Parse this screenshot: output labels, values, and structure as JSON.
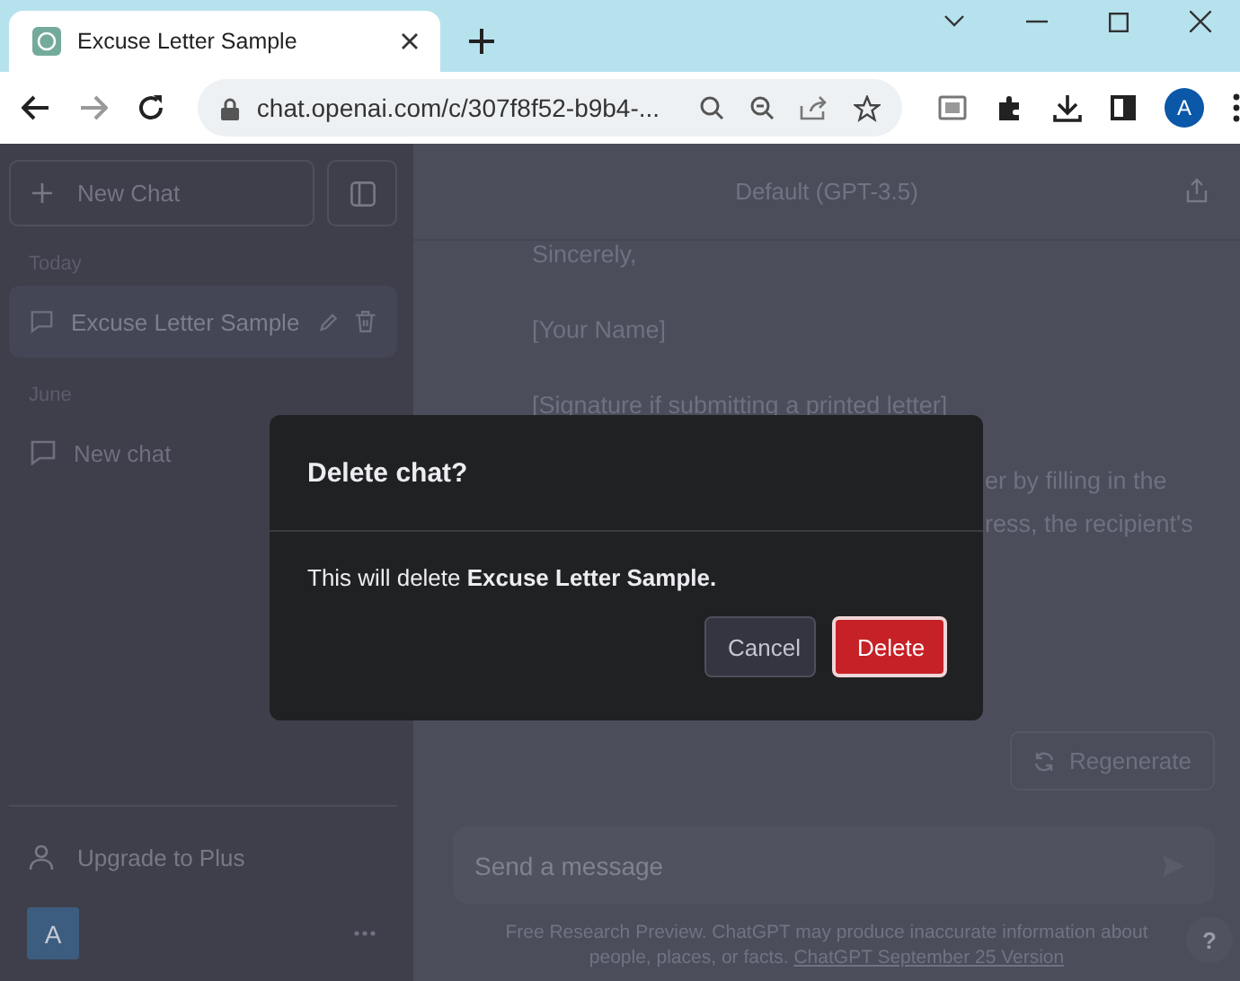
{
  "browser": {
    "tab": {
      "title": "Excuse Letter Sample",
      "selected": true
    },
    "url": "chat.openai.com/c/307f8f52-b9b4-...",
    "profile": "A"
  },
  "sidebar": {
    "new_chat": "New Chat",
    "sections": [
      {
        "heading": "Today",
        "items": [
          {
            "title": "Excuse Letter Sample",
            "selected": true
          }
        ]
      },
      {
        "heading": "June",
        "items": [
          {
            "title": "New chat",
            "selected": false
          }
        ]
      }
    ],
    "upgrade": "Upgrade to Plus",
    "user_avatar": "A"
  },
  "main": {
    "model": "Default (GPT-3.5)",
    "lines": [
      "Sincerely,",
      "[Your Name]",
      "[Signature if submitting a printed letter]"
    ],
    "partial_lines": [
      "er by filling in the",
      "ress, the recipient's"
    ],
    "regenerate": "Regenerate",
    "help": "?",
    "input": {
      "placeholder": "Send a message"
    },
    "footer": {
      "text": "Free Research Preview. ChatGPT may produce inaccurate information about people, places, or facts. ",
      "link": "ChatGPT September 25 Version"
    }
  },
  "dialog": {
    "title": "Delete chat?",
    "body": "This will delete **Excuse Letter Sample.**",
    "buttons": [
      {
        "label": "Cancel",
        "kind": "secondary"
      },
      {
        "label": "Delete",
        "kind": "danger"
      }
    ]
  }
}
